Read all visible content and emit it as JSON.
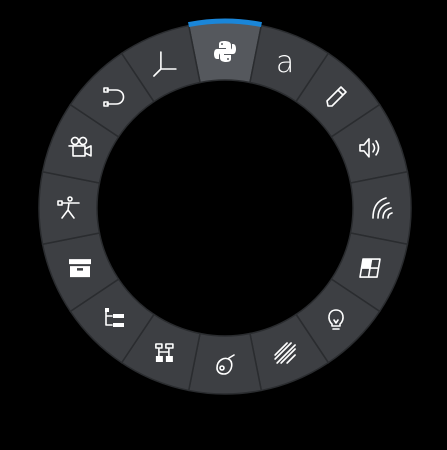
{
  "colors": {
    "background": "#000000",
    "ring": "#3d3f43",
    "selected": "#55585d",
    "divider": "#2a2c2f",
    "accent": "#1a86d9",
    "icon": "#ffffff"
  },
  "pie_menu": {
    "selected_index": 0,
    "items": [
      {
        "icon": "python-icon"
      },
      {
        "icon": "font-icon",
        "label": "a"
      },
      {
        "icon": "pencil-icon"
      },
      {
        "icon": "speaker-icon"
      },
      {
        "icon": "sound-wave-icon"
      },
      {
        "icon": "grid-icon"
      },
      {
        "icon": "lightbulb-icon"
      },
      {
        "icon": "hatch-icon"
      },
      {
        "icon": "paint-bucket-icon"
      },
      {
        "icon": "node-tree-icon"
      },
      {
        "icon": "outliner-icon"
      },
      {
        "icon": "archive-icon"
      },
      {
        "icon": "armature-icon"
      },
      {
        "icon": "camera-icon"
      },
      {
        "icon": "curve-icon"
      },
      {
        "icon": "axis-icon"
      }
    ]
  }
}
